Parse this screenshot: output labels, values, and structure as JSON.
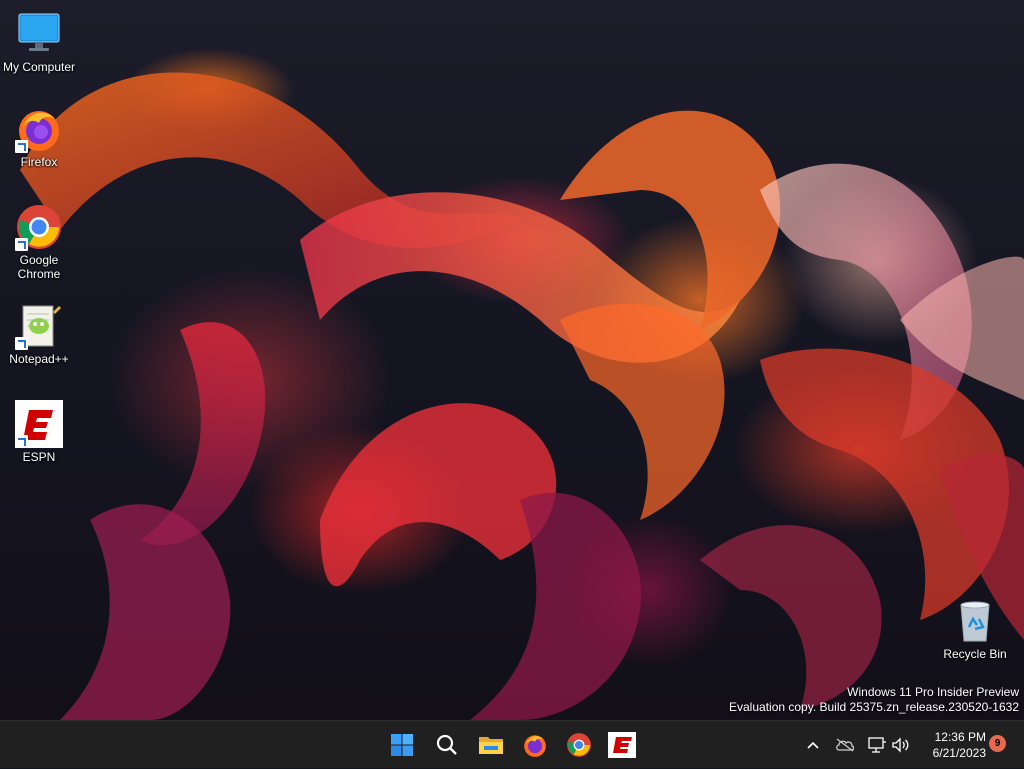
{
  "desktop": {
    "icons": [
      {
        "label": "My Computer",
        "icon": "monitor-icon"
      },
      {
        "label": "Firefox",
        "icon": "firefox-icon"
      },
      {
        "label": "Google Chrome",
        "icon": "chrome-icon"
      },
      {
        "label": "Notepad++",
        "icon": "notepadpp-icon"
      },
      {
        "label": "ESPN",
        "icon": "espn-icon"
      },
      {
        "label": "Recycle Bin",
        "icon": "recycle-bin-icon"
      }
    ],
    "watermark": {
      "line1": "Windows 11 Pro Insider Preview",
      "line2": "Evaluation copy. Build 25375.zn_release.230520-1632"
    }
  },
  "taskbar": {
    "apps": [
      "start-icon",
      "search-icon",
      "file-explorer-icon",
      "firefox-icon",
      "chrome-icon",
      "espn-icon"
    ],
    "tray": [
      "chevron-up-icon",
      "onedrive-icon",
      "network-icon",
      "volume-icon"
    ],
    "time": "12:36 PM",
    "date": "6/21/2023",
    "notification_count": "9"
  },
  "colors": {
    "taskbar": "#202020",
    "espn_red": "#d00000",
    "notification": "#e86a4e"
  }
}
